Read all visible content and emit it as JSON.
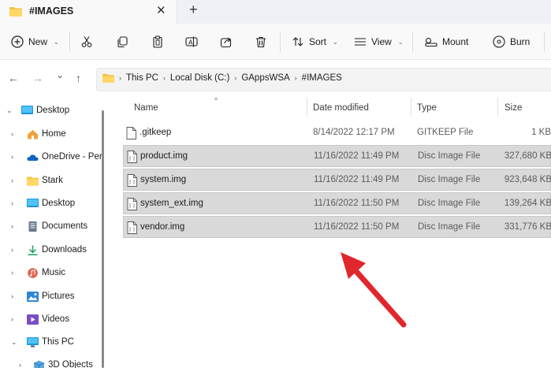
{
  "tab": {
    "title": "#IMAGES",
    "close": "✕",
    "new_tab": "+"
  },
  "toolbar": {
    "new_label": "New",
    "sort_label": "Sort",
    "view_label": "View",
    "mount_label": "Mount",
    "burn_label": "Burn"
  },
  "nav": {
    "back": "←",
    "forward": "→",
    "recent": "⌄",
    "up": "↑"
  },
  "breadcrumb": [
    "This PC",
    "Local Disk (C:)",
    "GAppsWSA",
    "#IMAGES"
  ],
  "sidebar": {
    "items": [
      {
        "label": "Desktop",
        "chev": "⌄"
      },
      {
        "label": "Home",
        "chev": "›"
      },
      {
        "label": "OneDrive - Per",
        "chev": "›"
      },
      {
        "label": "Stark",
        "chev": "›"
      },
      {
        "label": "Desktop",
        "chev": "›"
      },
      {
        "label": "Documents",
        "chev": "›"
      },
      {
        "label": "Downloads",
        "chev": "›"
      },
      {
        "label": "Music",
        "chev": "›"
      },
      {
        "label": "Pictures",
        "chev": "›"
      },
      {
        "label": "Videos",
        "chev": "›"
      },
      {
        "label": "This PC",
        "chev": "⌄"
      },
      {
        "label": "3D Objects",
        "chev": "›"
      }
    ]
  },
  "columns": {
    "name": "Name",
    "date": "Date modified",
    "type": "Type",
    "size": "Size"
  },
  "files": [
    {
      "name": ".gitkeep",
      "date": "8/14/2022 12:17 PM",
      "type": "GITKEEP File",
      "size": "1 KB",
      "selected": false
    },
    {
      "name": "product.img",
      "date": "11/16/2022 11:49 PM",
      "type": "Disc Image File",
      "size": "327,680 KB",
      "selected": true
    },
    {
      "name": "system.img",
      "date": "11/16/2022 11:49 PM",
      "type": "Disc Image File",
      "size": "923,648 KB",
      "selected": true
    },
    {
      "name": "system_ext.img",
      "date": "11/16/2022 11:50 PM",
      "type": "Disc Image File",
      "size": "139,264 KB",
      "selected": true
    },
    {
      "name": "vendor.img",
      "date": "11/16/2022 11:50 PM",
      "type": "Disc Image File",
      "size": "331,776 KB",
      "selected": true
    }
  ],
  "colors": {
    "folder": "#f5c242",
    "selection": "#d9d9d9",
    "arrow": "#e0272d",
    "accent": "#0067c0"
  }
}
